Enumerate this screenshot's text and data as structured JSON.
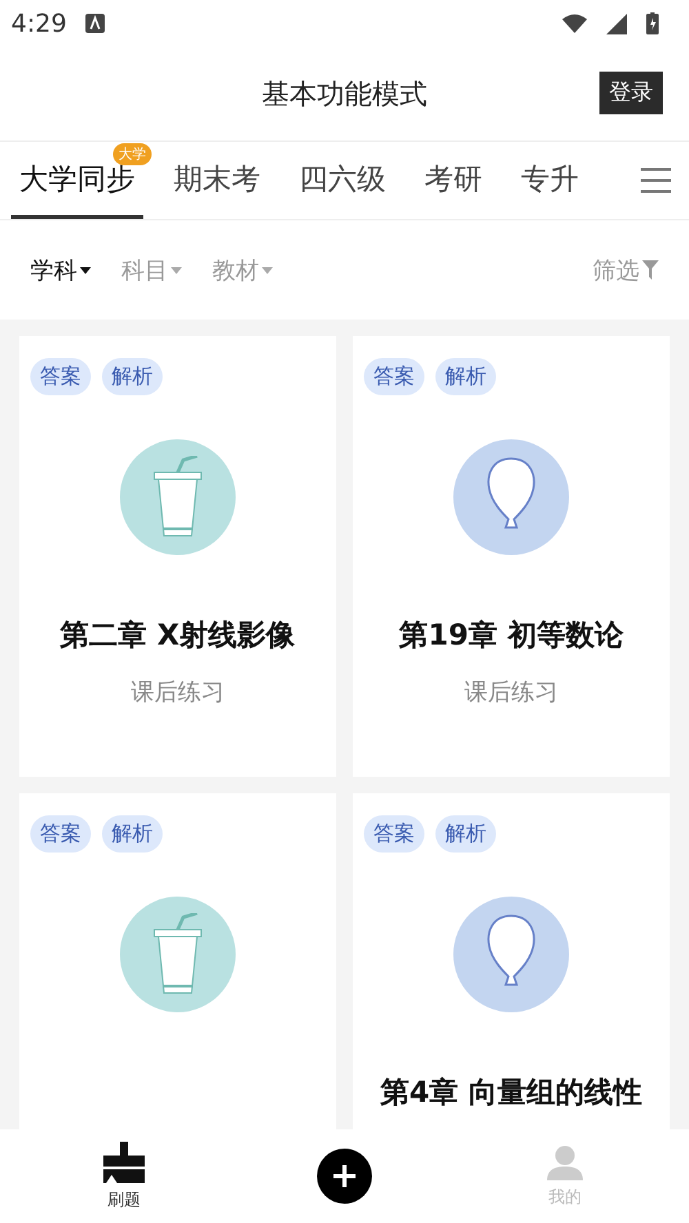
{
  "status_bar": {
    "time": "4:29"
  },
  "header": {
    "title": "基本功能模式",
    "login": "登录"
  },
  "tabs": [
    {
      "label": "大学同步",
      "selected": true,
      "badge": "大学"
    },
    {
      "label": "期末考",
      "selected": false
    },
    {
      "label": "四六级",
      "selected": false
    },
    {
      "label": "考研",
      "selected": false
    },
    {
      "label": "专升",
      "selected": false
    }
  ],
  "filters": [
    {
      "label": "学科",
      "selected": true
    },
    {
      "label": "科目",
      "selected": false
    },
    {
      "label": "教材",
      "selected": false
    }
  ],
  "filter_button": "筛选",
  "cards": [
    {
      "tags": [
        "答案",
        "解析"
      ],
      "kind": "cup",
      "color": "#b9e1e1",
      "title": "第二章 X射线影像",
      "subtitle": "课后练习"
    },
    {
      "tags": [
        "答案",
        "解析"
      ],
      "kind": "balloon",
      "color": "#c3d5f0",
      "title": "第19章 初等数论",
      "subtitle": "课后练习"
    },
    {
      "tags": [
        "答案",
        "解析"
      ],
      "kind": "cup",
      "color": "#b9e1e1"
    },
    {
      "tags": [
        "答案",
        "解析"
      ],
      "kind": "balloon",
      "color": "#c3d5f0",
      "title": "第4章 向量组的线性"
    }
  ],
  "nav": [
    {
      "kind": "brush",
      "label": "刷题",
      "selected": true
    },
    {
      "kind": "add"
    },
    {
      "kind": "person",
      "label": "我的",
      "selected": false
    }
  ]
}
